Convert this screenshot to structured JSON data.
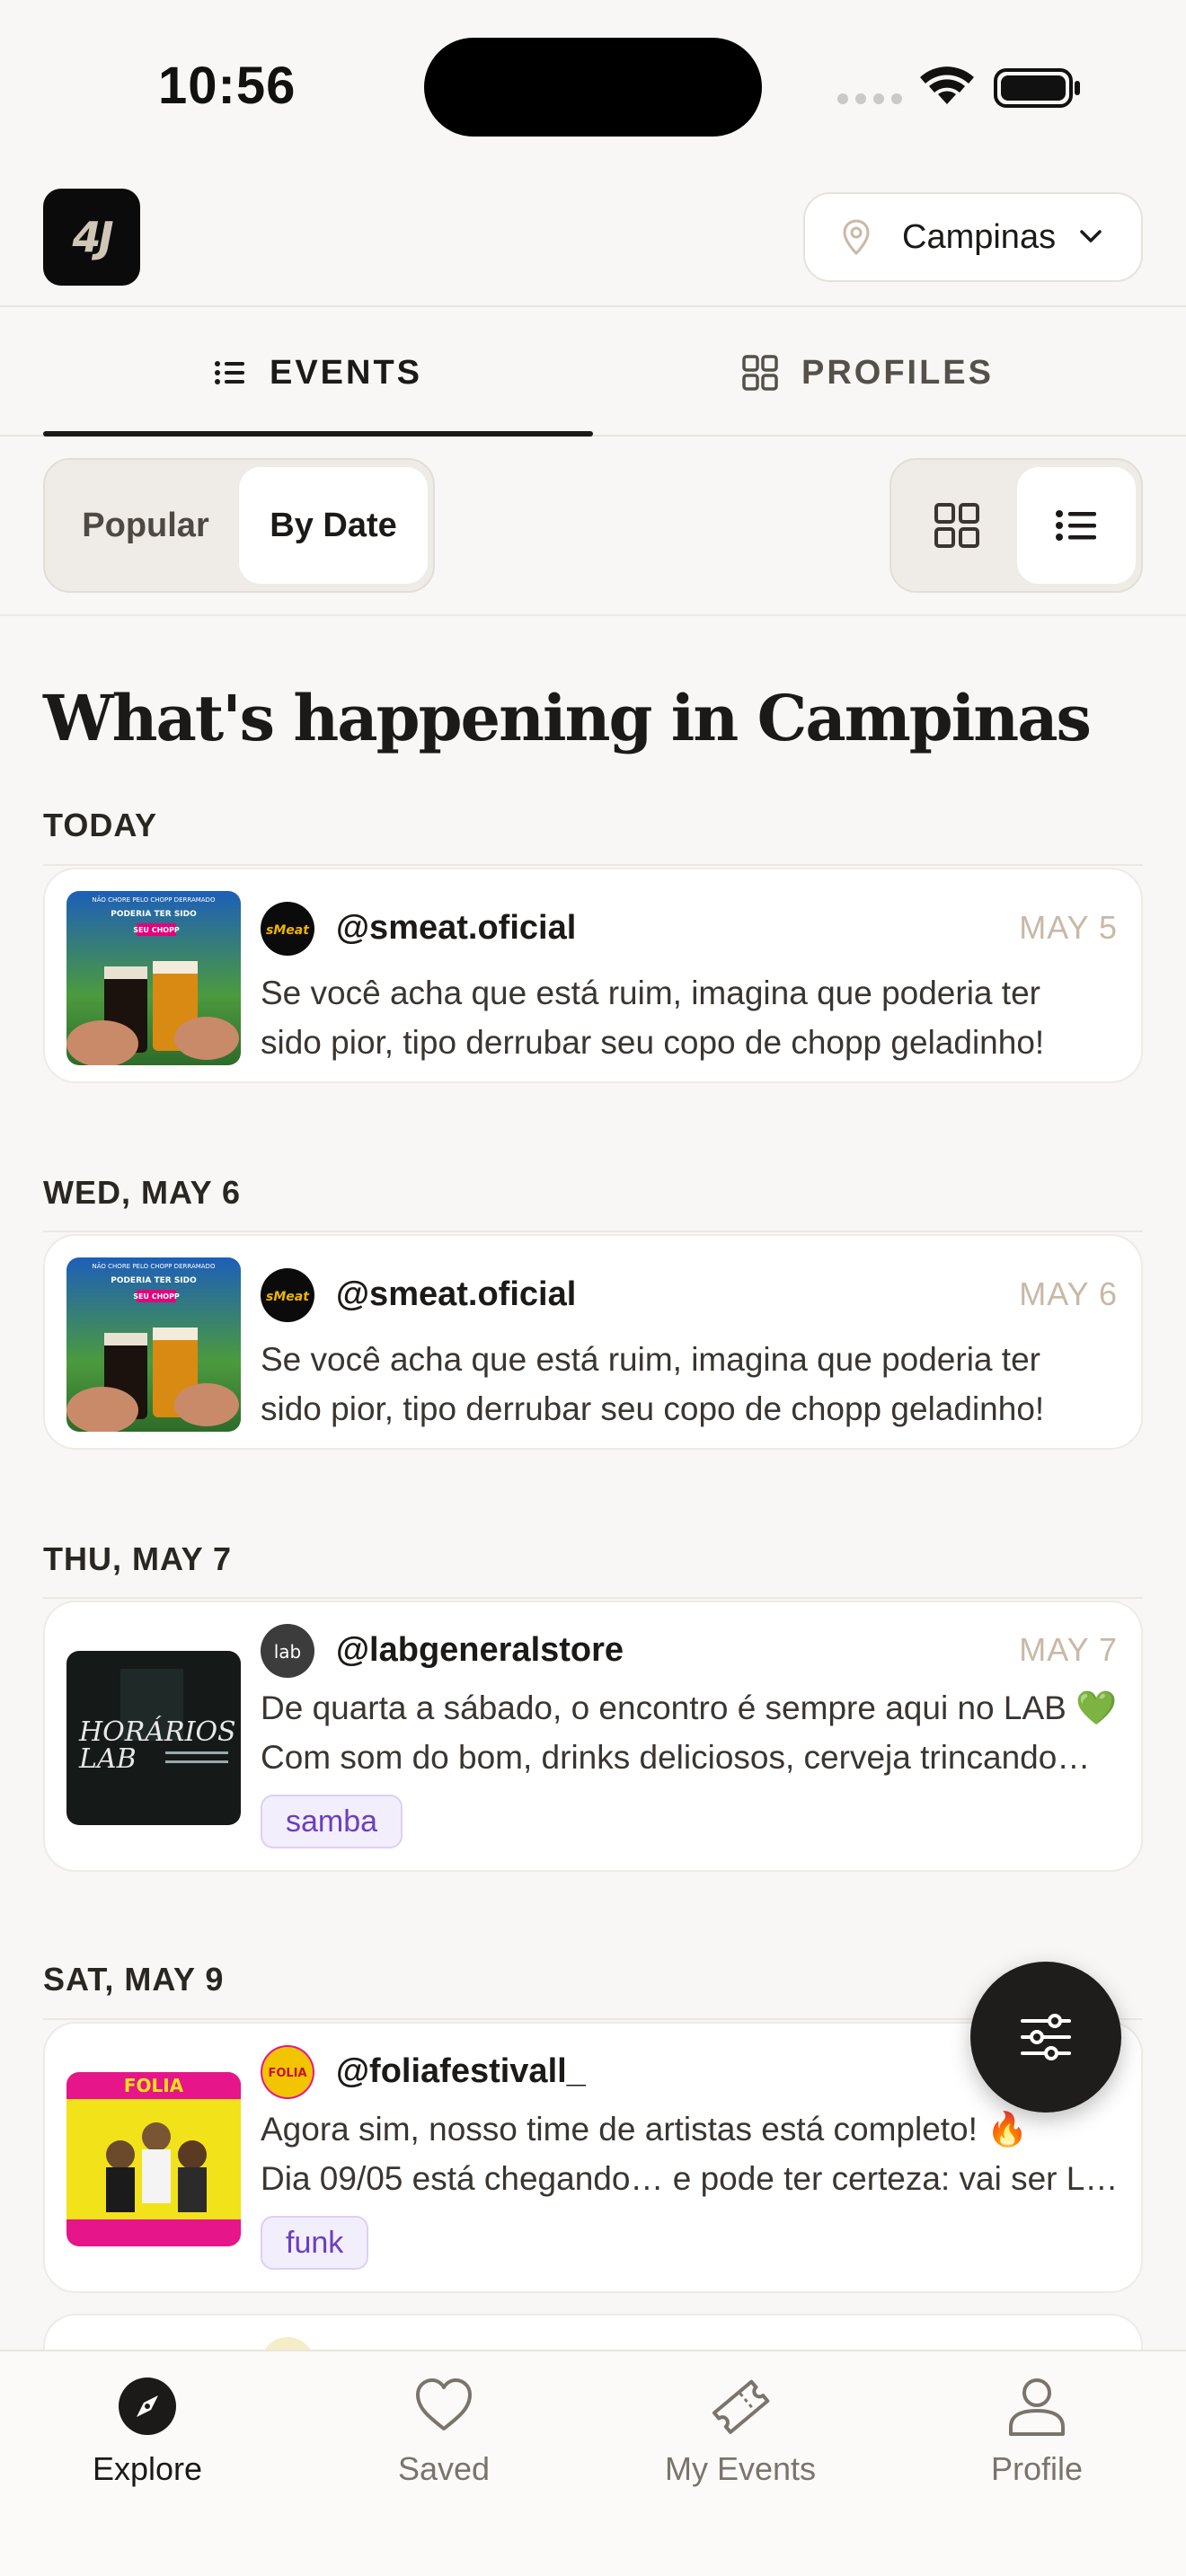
{
  "status_bar": {
    "time": "10:56"
  },
  "header": {
    "logo_text": "4J",
    "city": "Campinas"
  },
  "tabs": [
    {
      "label": "EVENTS",
      "icon": "list-icon",
      "active": true
    },
    {
      "label": "PROFILES",
      "icon": "grid-icon",
      "active": false
    }
  ],
  "sort": {
    "options": [
      "Popular",
      "By Date"
    ],
    "selected": "By Date"
  },
  "view_mode": {
    "options": [
      "grid-icon",
      "list-icon"
    ],
    "selected": "list"
  },
  "page_title": "What's happening in Campinas",
  "sections": [
    {
      "label": "TODAY",
      "events": [
        {
          "handle": "@smeat.oficial",
          "date": "MAY 5",
          "line1": "Se você acha que está ruim, imagina que poderia ter",
          "line2": "sido pior, tipo derrubar seu copo de chopp geladinho!",
          "tag": ""
        }
      ]
    },
    {
      "label": "WED, MAY 6",
      "events": [
        {
          "handle": "@smeat.oficial",
          "date": "MAY 6",
          "line1": "Se você acha que está ruim, imagina que poderia ter",
          "line2": "sido pior, tipo derrubar seu copo de chopp geladinho!",
          "tag": ""
        }
      ]
    },
    {
      "label": "THU, MAY 7",
      "events": [
        {
          "handle": "@labgeneralstore",
          "date": "MAY 7",
          "line1": "De quarta a sábado, o encontro é sempre aqui no LAB 💚",
          "line2": "Com som do bom, drinks deliciosos, cerveja trincando…",
          "tag": "samba"
        }
      ]
    },
    {
      "label": "SAT, MAY 9",
      "events": [
        {
          "handle": "@foliafestivall_",
          "date": "",
          "line1": "Agora sim, nosso time de artistas está completo! 🔥",
          "line2": "Dia 09/05 está chegando… e pode ter certeza: vai ser L…",
          "tag": "funk"
        }
      ]
    }
  ],
  "thumb_text": {
    "smeat_top": "NÃO CHORE PELO CHOPP DERRAMADO",
    "smeat_mid": "PODERIA TER SIDO",
    "smeat_bottom": "SEU CHOPP",
    "lab_title1": "HORÁRIOS",
    "lab_title2": "LAB",
    "folia_logo": "FOLIA",
    "smeat_avatar": "sMeat",
    "lab_avatar": "lab",
    "folia_avatar": "FOLIA"
  },
  "bottom_nav": [
    {
      "label": "Explore",
      "icon": "compass-icon",
      "active": true
    },
    {
      "label": "Saved",
      "icon": "heart-icon",
      "active": false
    },
    {
      "label": "My Events",
      "icon": "ticket-icon",
      "active": false
    },
    {
      "label": "Profile",
      "icon": "person-icon",
      "active": false
    }
  ],
  "colors": {
    "accent_date": "#c8b9a6",
    "tag_bg": "#f3eefc",
    "tag_text": "#6a3fc0"
  }
}
